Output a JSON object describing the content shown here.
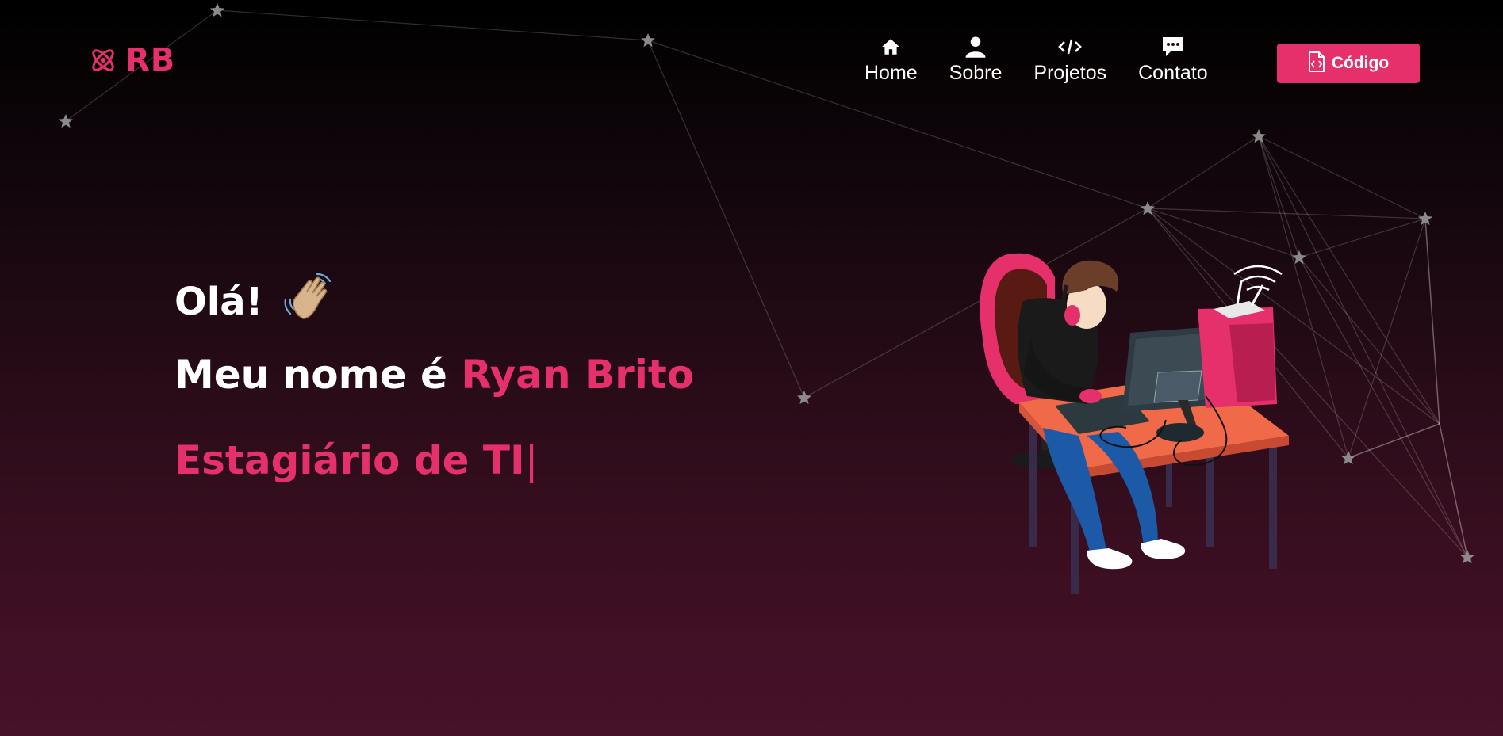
{
  "logo": {
    "text": "RB"
  },
  "nav": {
    "items": [
      {
        "label": "Home",
        "icon": "home-icon"
      },
      {
        "label": "Sobre",
        "icon": "user-icon"
      },
      {
        "label": "Projetos",
        "icon": "code-icon"
      },
      {
        "label": "Contato",
        "icon": "chat-icon"
      }
    ],
    "code_button": {
      "label": "Código",
      "icon": "file-code-icon"
    }
  },
  "hero": {
    "greeting": "Olá!",
    "greeting_emoji": "waving-hand-icon",
    "name_prefix": "Meu nome é",
    "name": "Ryan Brito",
    "role": "Estagiário de TI",
    "caret": "|"
  },
  "colors": {
    "accent": "#e5306b",
    "background_top": "#000000",
    "background_bottom": "#46112a",
    "text": "#ffffff"
  }
}
